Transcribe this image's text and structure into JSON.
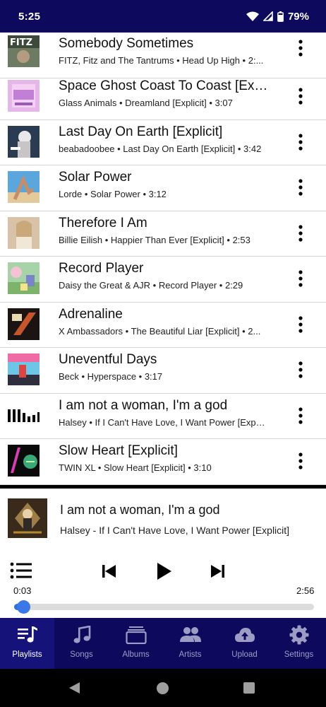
{
  "status_bar": {
    "time": "5:25",
    "battery": "79%"
  },
  "songs": [
    {
      "title": "Somebody Sometimes",
      "subtitle": "FITZ, Fitz and The Tantrums • Head Up High • 2:..."
    },
    {
      "title": "Space Ghost Coast To Coast [Explicit]",
      "subtitle": "Glass Animals • Dreamland [Explicit] • 3:07"
    },
    {
      "title": "Last Day On Earth [Explicit]",
      "subtitle": "beabadoobee • Last Day On Earth [Explicit] • 3:42"
    },
    {
      "title": "Solar Power",
      "subtitle": "Lorde • Solar Power • 3:12"
    },
    {
      "title": "Therefore I Am",
      "subtitle": "Billie Eilish • Happier Than Ever [Explicit] • 2:53"
    },
    {
      "title": "Record Player",
      "subtitle": "Daisy the Great & AJR • Record Player • 2:29"
    },
    {
      "title": "Adrenaline",
      "subtitle": "X Ambassadors • The Beautiful Liar [Explicit] • 2..."
    },
    {
      "title": "Uneventful Days",
      "subtitle": "Beck • Hyperspace • 3:17"
    },
    {
      "title": "I am not a woman, I'm a god",
      "subtitle": "Halsey • If I Can't Have Love, I Want Power [Expli..."
    },
    {
      "title": "Slow Heart [Explicit]",
      "subtitle": "TWIN XL • Slow Heart [Explicit] • 3:10"
    }
  ],
  "now_playing": {
    "title": "I am not a woman, I'm a god",
    "subtitle": "Halsey - If I Can't Have Love, I Want Power [Explicit]",
    "current_time": "0:03",
    "total_time": "2:56",
    "progress_fraction": 0.017
  },
  "nav": {
    "playlists": "Playlists",
    "songs": "Songs",
    "albums": "Albums",
    "artists": "Artists",
    "upload": "Upload",
    "settings": "Settings",
    "active": "playlists"
  },
  "colors": {
    "nav_background": "#0d0a5e",
    "accent": "#3b78e7",
    "inactive_label": "#9c9cc4"
  }
}
